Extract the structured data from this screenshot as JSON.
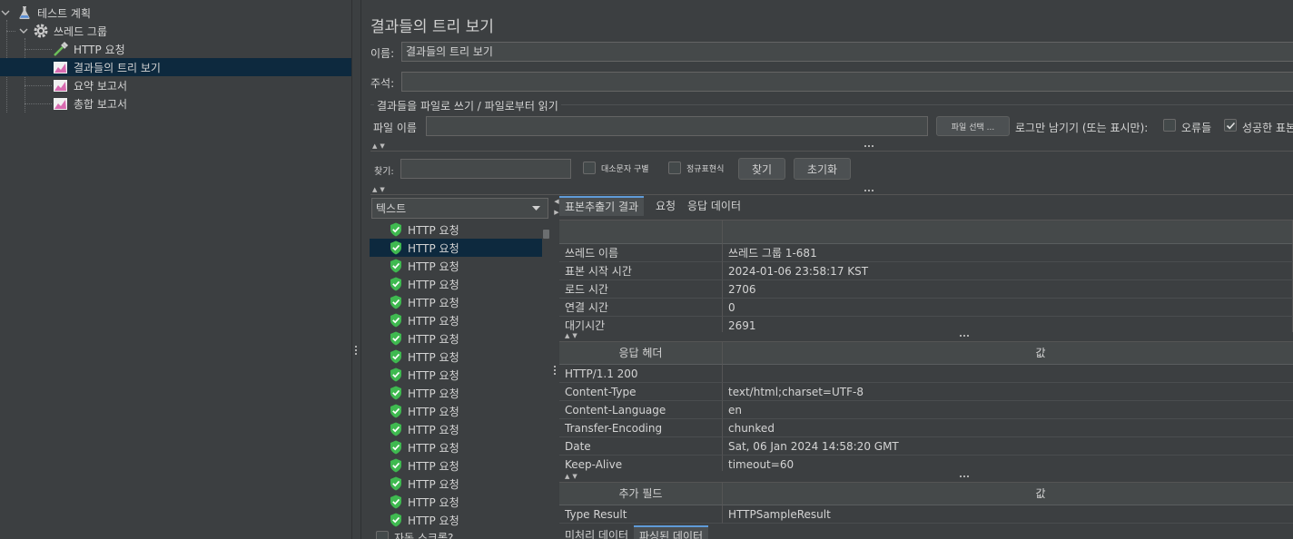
{
  "tree": {
    "items": [
      {
        "label": "테스트 계획",
        "icon": "flask-icon"
      },
      {
        "label": "쓰레드 그룹",
        "icon": "gear-icon"
      },
      {
        "label": "HTTP 요청",
        "icon": "pipette-icon"
      },
      {
        "label": "결과들의 트리 보기",
        "icon": "chart-icon"
      },
      {
        "label": "요약 보고서",
        "icon": "chart-icon"
      },
      {
        "label": "총합 보고서",
        "icon": "chart-icon"
      }
    ]
  },
  "panel": {
    "title": "결과들의 트리 보기",
    "name_label": "이름:",
    "name_value": "결과들의 트리 보기",
    "comment_label": "주석:",
    "comment_value": "",
    "file_group_title": "결과들을 파일로 쓰기 / 파일로부터 읽기",
    "filename_label": "파일 이름",
    "filename_value": "",
    "browse_button": "파일 선택 ...",
    "log_only_label": "로그만 남기기 (또는 표시만):",
    "errors_label": "오류들",
    "errors_checked": false,
    "success_label": "성공한 표본",
    "success_checked": true
  },
  "search": {
    "label": "찾기:",
    "value": "",
    "case_label": "대소문자 구별",
    "regex_label": "정규표현식",
    "find_button": "찾기",
    "reset_button": "초기화"
  },
  "results": {
    "renderer": "텍스트",
    "items": [
      "HTTP 요청",
      "HTTP 요청",
      "HTTP 요청",
      "HTTP 요청",
      "HTTP 요청",
      "HTTP 요청",
      "HTTP 요청",
      "HTTP 요청",
      "HTTP 요청",
      "HTTP 요청",
      "HTTP 요청",
      "HTTP 요청",
      "HTTP 요청",
      "HTTP 요청",
      "HTTP 요청",
      "HTTP 요청",
      "HTTP 요청"
    ],
    "selected_index": 1,
    "autoscroll_label": "자동 스크롤?"
  },
  "detail": {
    "tabs": [
      "표본추출기 결과",
      "요청",
      "응답 데이터"
    ],
    "active_tab": 0,
    "sampler_rows": [
      {
        "k": "쓰레드 이름",
        "v": "쓰레드 그룹 1-681"
      },
      {
        "k": "표본 시작 시간",
        "v": "2024-01-06 23:58:17 KST"
      },
      {
        "k": "로드 시간",
        "v": "2706"
      },
      {
        "k": "연결 시간",
        "v": "0"
      },
      {
        "k": "대기시간",
        "v": "2691"
      }
    ],
    "header_table": {
      "col1": "응답 헤더",
      "col2": "값",
      "rows": [
        {
          "k": "HTTP/1.1 200",
          "v": ""
        },
        {
          "k": "Content-Type",
          "v": "text/html;charset=UTF-8"
        },
        {
          "k": "Content-Language",
          "v": "en"
        },
        {
          "k": "Transfer-Encoding",
          "v": "chunked"
        },
        {
          "k": "Date",
          "v": "Sat, 06 Jan 2024 14:58:20 GMT"
        },
        {
          "k": "Keep-Alive",
          "v": "timeout=60"
        }
      ]
    },
    "extra_table": {
      "col1": "추가 필드",
      "col2": "값",
      "rows": [
        {
          "k": "Type Result",
          "v": "HTTPSampleResult"
        }
      ]
    },
    "bottom_tabs": [
      "미처리 데이터",
      "파싱된 데이터"
    ],
    "bottom_active": 1
  },
  "colors": {
    "background": "#3c3f41",
    "selection": "#0d293e",
    "shield": "#3fb950"
  }
}
